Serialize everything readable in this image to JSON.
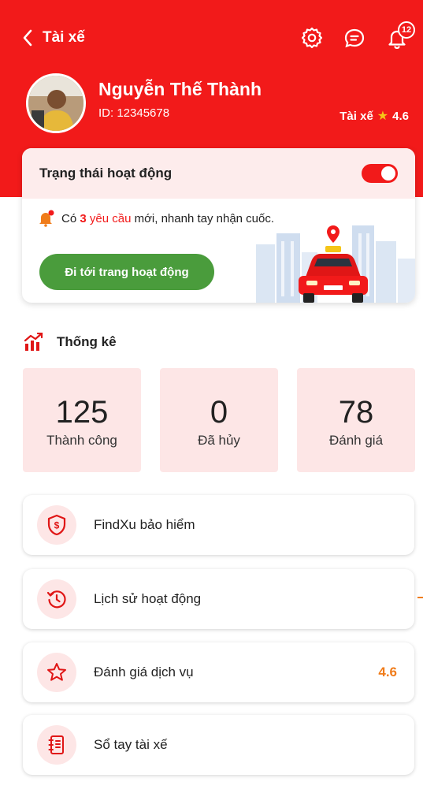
{
  "header": {
    "back_label": "Tài xế",
    "notification_count": "12"
  },
  "profile": {
    "name": "Nguyễn Thế Thành",
    "id_text": "ID: 12345678",
    "role_label": "Tài xế",
    "rating": "4.6"
  },
  "status": {
    "title": "Trạng thái hoạt động",
    "toggle_on": true,
    "notice_prefix": "Có",
    "notice_count": "3",
    "notice_request": "yêu cầu",
    "notice_suffix": "mới, nhanh tay nhận cuốc.",
    "button_label": "Đi tới trang hoạt động"
  },
  "stats": {
    "title": "Thống kê",
    "items": [
      {
        "value": "125",
        "label": "Thành công"
      },
      {
        "value": "0",
        "label": "Đã hủy"
      },
      {
        "value": "78",
        "label": "Đánh giá"
      }
    ]
  },
  "menu": [
    {
      "label": "FindXu bảo hiểm",
      "icon": "insurance-shield-icon"
    },
    {
      "label": "Lịch sử hoạt động",
      "icon": "history-icon"
    },
    {
      "label": "Đánh giá dịch vụ",
      "icon": "star-icon",
      "value": "4.6"
    },
    {
      "label": "Sổ tay tài xế",
      "icon": "notebook-icon"
    }
  ],
  "colors": {
    "primary": "#f21a1a",
    "button_green": "#4a9c3c",
    "tile_bg": "#fde6e6",
    "value_orange": "#f07c1a",
    "star_yellow": "#f5c518"
  }
}
